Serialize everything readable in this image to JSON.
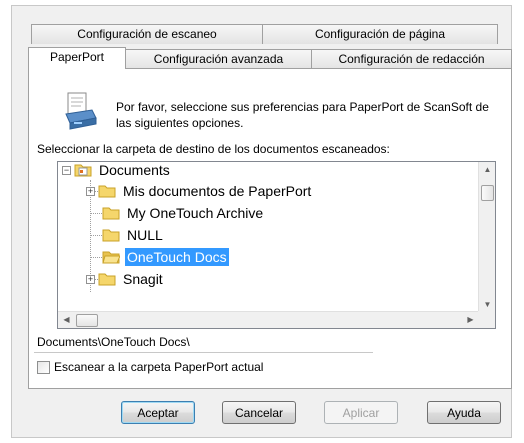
{
  "tabs": {
    "row1": [
      {
        "label": "Configuración de escaneo"
      },
      {
        "label": "Configuración de página"
      }
    ],
    "row2": [
      {
        "label": "PaperPort",
        "active": true
      },
      {
        "label": "Configuración avanzada"
      },
      {
        "label": "Configuración de redacción"
      }
    ]
  },
  "intro_text": "Por favor, seleccione sus preferencias para PaperPort de ScanSoft de las siguientes opciones.",
  "folder_label": "Seleccionar la carpeta de destino de los documentos escaneados:",
  "tree": {
    "root": "Documents",
    "children": [
      {
        "label": "Mis documentos de PaperPort",
        "expandable": true
      },
      {
        "label": "My OneTouch Archive",
        "expandable": false
      },
      {
        "label": "NULL",
        "expandable": false
      },
      {
        "label": "OneTouch Docs",
        "expandable": false,
        "selected": true
      },
      {
        "label": "Snagit",
        "expandable": true
      }
    ]
  },
  "selected_path": "Documents\\OneTouch Docs\\",
  "checkbox_label": "Escanear a la carpeta PaperPort actual",
  "buttons": {
    "accept": "Aceptar",
    "cancel": "Cancelar",
    "apply": "Aplicar",
    "help": "Ayuda"
  },
  "colors": {
    "selection": "#3399ff",
    "folder": "#f5d66b",
    "dialog_bg": "#f0f0f0"
  }
}
